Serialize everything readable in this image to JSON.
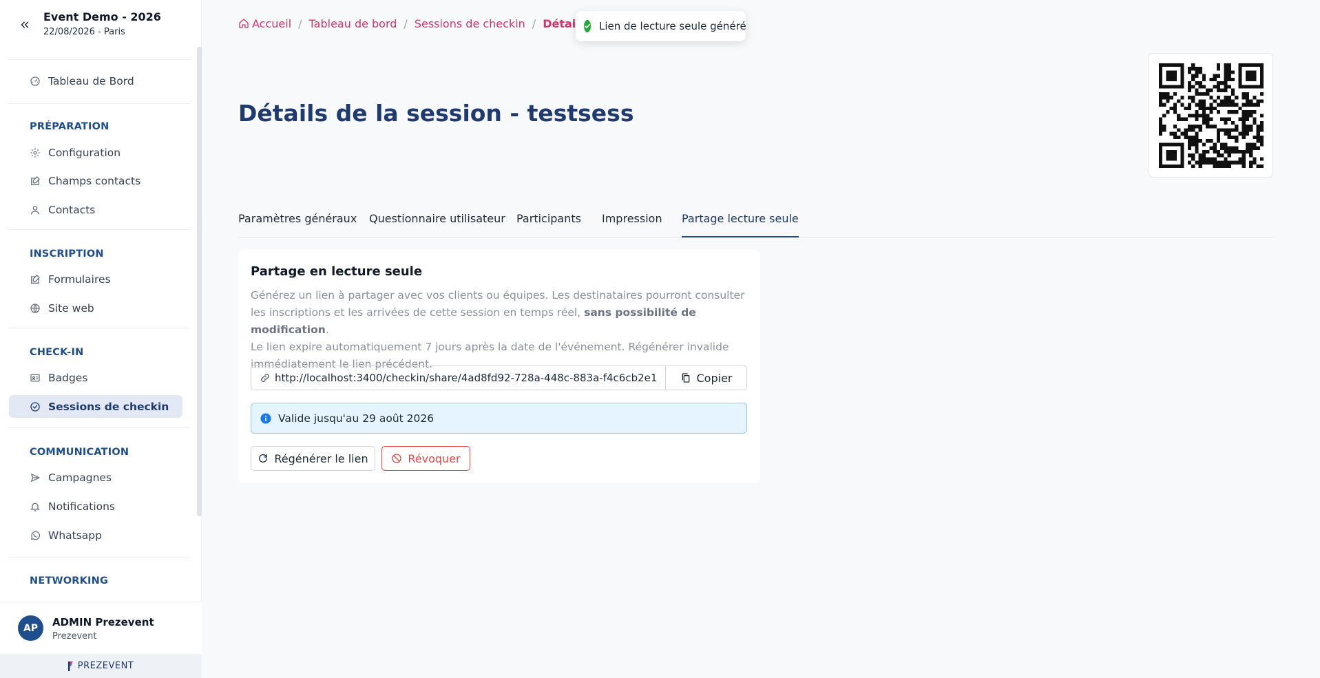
{
  "sidebar": {
    "event_title": "Event Demo - 2026",
    "event_subtitle": "22/08/2026 - Paris",
    "dashboard": "Tableau de Bord",
    "sections": {
      "preparation": "PRÉPARATION",
      "inscription": "INSCRIPTION",
      "checkin": "CHECK-IN",
      "communication": "COMMUNICATION",
      "networking": "NETWORKING"
    },
    "items": {
      "configuration": "Configuration",
      "champs_contacts": "Champs contacts",
      "contacts": "Contacts",
      "formulaires": "Formulaires",
      "site_web": "Site web",
      "badges": "Badges",
      "sessions_checkin": "Sessions de checkin",
      "campagnes": "Campagnes",
      "notifications": "Notifications",
      "whatsapp": "Whatsapp"
    },
    "user": {
      "initials": "AP",
      "name": "ADMIN Prezevent",
      "org": "Prezevent"
    },
    "brand": "PREZEVENT"
  },
  "breadcrumb": {
    "home": "Accueil",
    "dashboard": "Tableau de bord",
    "sessions": "Sessions de checkin",
    "current": "Détails",
    "separator": "/"
  },
  "toast": {
    "message": "Lien de lecture seule généré"
  },
  "page": {
    "title": "Détails de la session - testsess"
  },
  "tabs": {
    "general": "Paramètres généraux",
    "questionnaire": "Questionnaire utilisateur",
    "participants": "Participants",
    "impression": "Impression",
    "partage": "Partage lecture seule"
  },
  "share_card": {
    "title": "Partage en lecture seule",
    "desc_part1": "Générez un lien à partager avec vos clients ou équipes. Les destinataires pourront consulter les inscriptions et les arrivées de cette session en temps réel, ",
    "desc_bold": "sans possibilité de modification",
    "desc_part2": ".",
    "desc_line2": "Le lien expire automatiquement 7 jours après la date de l'événement. Régénérer invalide immédiatement le lien précédent.",
    "link_value": "http://localhost:3400/checkin/share/4ad8fd92-728a-448c-883a-f4c6cb2e1",
    "copy_label": "Copier",
    "validity": "Valide jusqu'au 29 août 2026",
    "regenerate_label": "Régénérer le lien",
    "revoke_label": "Révoquer"
  },
  "colors": {
    "accent_pink": "#d6336c",
    "primary_navy": "#1e3a6e",
    "success_green": "#22a83a",
    "info_blue": "#1677ff",
    "danger_red": "#ef4444"
  },
  "icons": {
    "collapse": "double-chevron-left-icon",
    "home": "home-icon",
    "link": "link-icon",
    "copy": "copy-icon",
    "info": "info-icon",
    "refresh": "refresh-icon",
    "ban": "ban-icon"
  }
}
